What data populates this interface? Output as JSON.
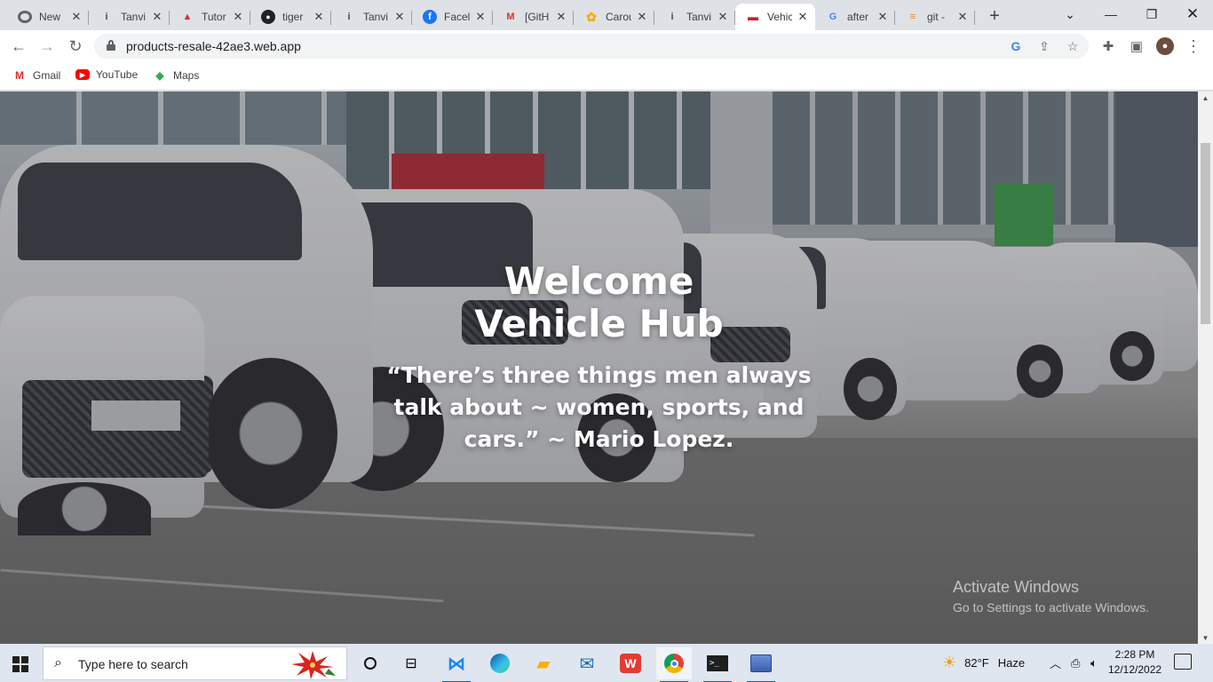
{
  "browser": {
    "tabs": [
      {
        "title": "New",
        "icon": "chrome-icon",
        "color": "#5f6368"
      },
      {
        "title": "Tanvi",
        "icon": "person-icon",
        "color": "#5d4037"
      },
      {
        "title": "Tutor",
        "icon": "tutorial-icon",
        "color": "#d93025"
      },
      {
        "title": "tiger",
        "icon": "github-icon",
        "color": "#202124"
      },
      {
        "title": "Tanvi",
        "icon": "person-icon",
        "color": "#5d4037"
      },
      {
        "title": "Facel",
        "icon": "facebook-icon",
        "color": "#1877f2"
      },
      {
        "title": "[GitH",
        "icon": "gmail-icon",
        "color": "#d93025"
      },
      {
        "title": "Carou",
        "icon": "sunflower-icon",
        "color": "#f9ab00"
      },
      {
        "title": "Tanvi",
        "icon": "person-icon",
        "color": "#5d4037"
      },
      {
        "title": "Vehic",
        "icon": "car-icon",
        "color": "#c5221f",
        "active": true
      },
      {
        "title": "after",
        "icon": "google-icon",
        "color": "#4285f4"
      },
      {
        "title": "git -",
        "icon": "stackoverflow-icon",
        "color": "#f48024"
      }
    ],
    "url": "products-resale-42ae3.web.app",
    "bookmarks": [
      {
        "label": "Gmail",
        "icon": "gmail-icon"
      },
      {
        "label": "YouTube",
        "icon": "youtube-icon"
      },
      {
        "label": "Maps",
        "icon": "maps-icon"
      }
    ]
  },
  "page": {
    "title_line1": "Welcome",
    "title_line2": "Vehicle Hub",
    "quote": "“There’s three things men always talk about ~ women, sports, and cars.” ~ Mario Lopez."
  },
  "watermark": {
    "line1": "Activate Windows",
    "line2": "Go to Settings to activate Windows."
  },
  "taskbar": {
    "search_placeholder": "Type here to search",
    "weather_temp": "82°F",
    "weather_desc": "Haze",
    "time": "2:28 PM",
    "date": "12/12/2022",
    "accent": "#0067c0"
  }
}
